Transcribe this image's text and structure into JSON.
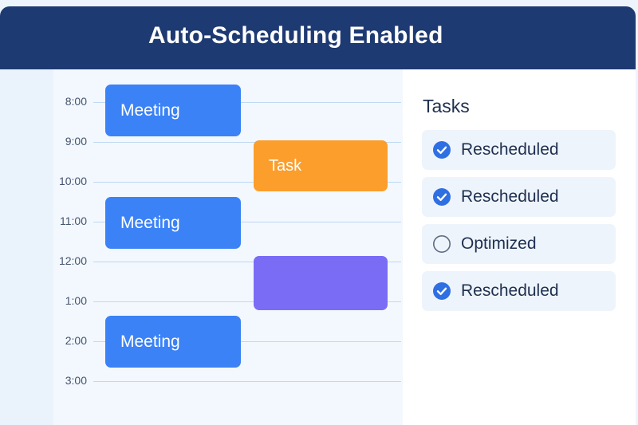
{
  "header": {
    "title": "Auto-Scheduling Enabled"
  },
  "calendar": {
    "times": [
      "8:00",
      "9:00",
      "10:00",
      "11:00",
      "12:00",
      "1:00",
      "2:00",
      "3:00"
    ],
    "events": [
      {
        "label": "Meeting",
        "type": "meeting",
        "color": "#3b82f6"
      },
      {
        "label": "Task",
        "type": "task",
        "color": "#fb9e2c"
      },
      {
        "label": "Meeting",
        "type": "meeting",
        "color": "#3b82f6"
      },
      {
        "label": "",
        "type": "blank",
        "color": "#7b6cf6"
      },
      {
        "label": "Meeting",
        "type": "meeting",
        "color": "#3b82f6"
      }
    ]
  },
  "tasks": {
    "title": "Tasks",
    "items": [
      {
        "label": "Rescheduled",
        "checked": true,
        "icon": "check-circle-icon"
      },
      {
        "label": "Rescheduled",
        "checked": true,
        "icon": "check-circle-icon"
      },
      {
        "label": "Optimized",
        "checked": false,
        "icon": "empty-circle-icon"
      },
      {
        "label": "Rescheduled",
        "checked": true,
        "icon": "check-circle-icon"
      }
    ]
  },
  "colors": {
    "header_bg": "#1e3a72",
    "meeting": "#3b82f6",
    "task": "#fb9e2c",
    "purple_block": "#7b6cf6",
    "check": "#2f6fe4"
  }
}
